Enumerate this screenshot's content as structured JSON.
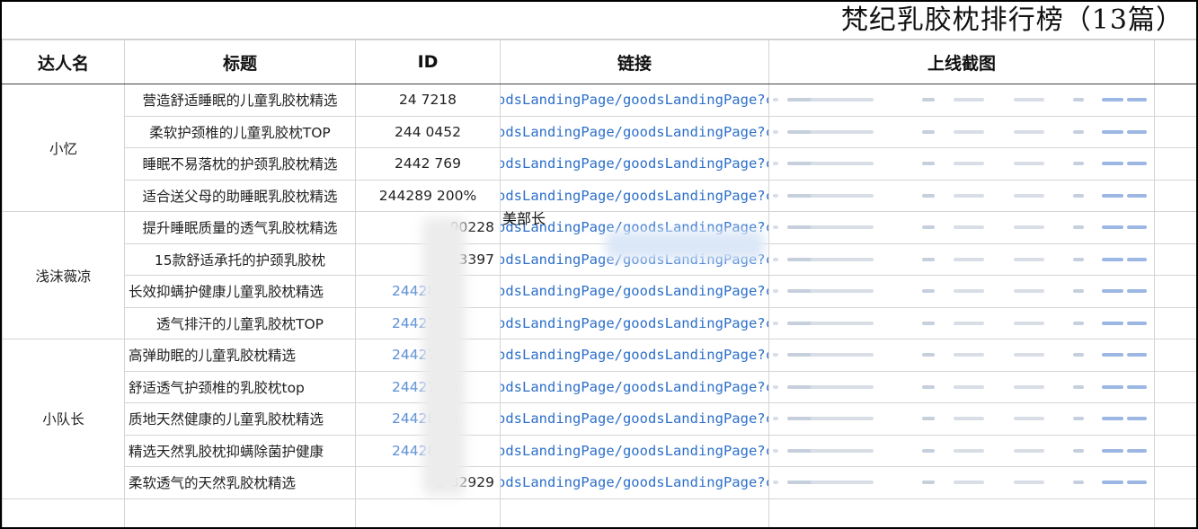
{
  "title": "梵纪乳胶枕排行榜（13篇）",
  "columns": [
    "达人名",
    "标题",
    "ID",
    "链接",
    "上线截图"
  ],
  "overlay_text": "美部长",
  "groups": [
    {
      "author": "小忆",
      "rows": [
        {
          "title": "营造舒适睡眠的儿童乳胶枕精选",
          "id": "24  7218",
          "link": "odsLandingPage/goodsLandingPage?cor"
        },
        {
          "title": "柔软护颈椎的儿童乳胶枕TOP",
          "id": "244  0452",
          "link": "odsLandingPage/goodsLandingPage?cor"
        },
        {
          "title": "睡眠不易落枕的护颈乳胶枕精选",
          "id": "2442  769",
          "link": "odsLandingPage/goodsLandingPage?cor"
        },
        {
          "title": "适合送父母的助睡眠乳胶枕精选",
          "id": "244289  200%",
          "link": "odsLandingPage/goodsLandingPage?cor"
        }
      ]
    },
    {
      "author": "浅沫薇凉",
      "rows": [
        {
          "title": "提升睡眠质量的透气乳胶枕精选",
          "id": "90228",
          "link": "odsLandingPage/goodsLandingPage?cor"
        },
        {
          "title": "15款舒适承托的护颈乳胶枕",
          "id": "3397",
          "link": "odsLandingPage/goodsLandingPage?cor"
        },
        {
          "title": "长效抑螨护健康儿童乳胶枕精选",
          "id": "24428",
          "link": "odsLandingPage/goodsLandingPage?cor"
        },
        {
          "title": "透气排汗的儿童乳胶枕TOP",
          "id": "24427",
          "link": "odsLandingPage/goodsLandingPage?cor"
        }
      ]
    },
    {
      "author": "小队长",
      "rows": [
        {
          "title": "高弹助眠的儿童乳胶枕精选",
          "id": "24427",
          "link": "odsLandingPage/goodsLandingPage?cor"
        },
        {
          "title": "舒适透气护颈椎的乳胶枕top",
          "id": "24427  90",
          "link": "odsLandingPage/goodsLandingPage?cor"
        },
        {
          "title": "质地天然健康的儿童乳胶枕精选",
          "id": "24428  08",
          "link": "odsLandingPage/goodsLandingPage?cor"
        },
        {
          "title": "精选天然乳胶枕抑螨除菌护健康",
          "id": "24428",
          "link": "odsLandingPage/goodsLandingPage?cor"
        },
        {
          "title": "柔软透气的天然乳胶枕精选",
          "id": "2  82929",
          "link": "odsLandingPage/goodsLandingPage?cor"
        }
      ]
    }
  ]
}
